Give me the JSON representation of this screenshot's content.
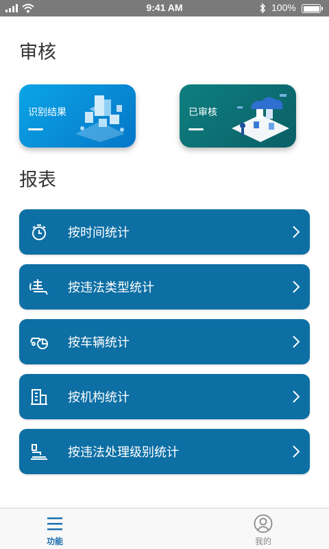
{
  "status_bar": {
    "time": "9:41 AM",
    "battery": "100%"
  },
  "sections": {
    "review_title": "审核",
    "reports_title": "报表"
  },
  "review_cards": [
    {
      "label": "识别结果",
      "color": "#0a8fd8"
    },
    {
      "label": "已审核",
      "color": "#0a6b70"
    }
  ],
  "reports": [
    {
      "label": "按时间统计",
      "icon": "stopwatch-icon"
    },
    {
      "label": "按违法类型统计",
      "icon": "violation-type-icon"
    },
    {
      "label": "按车辆统计",
      "icon": "vehicle-chart-icon"
    },
    {
      "label": "按机构统计",
      "icon": "building-icon"
    },
    {
      "label": "按违法处理级别统计",
      "icon": "level-chart-icon"
    }
  ],
  "tab_bar": {
    "functions_label": "功能",
    "mine_label": "我的",
    "active_color": "#1a6fb0",
    "inactive_color": "#8a8a8a"
  },
  "colors": {
    "report_item_bg": "#0d6fa4",
    "status_bar_bg": "#7a7a7a"
  }
}
